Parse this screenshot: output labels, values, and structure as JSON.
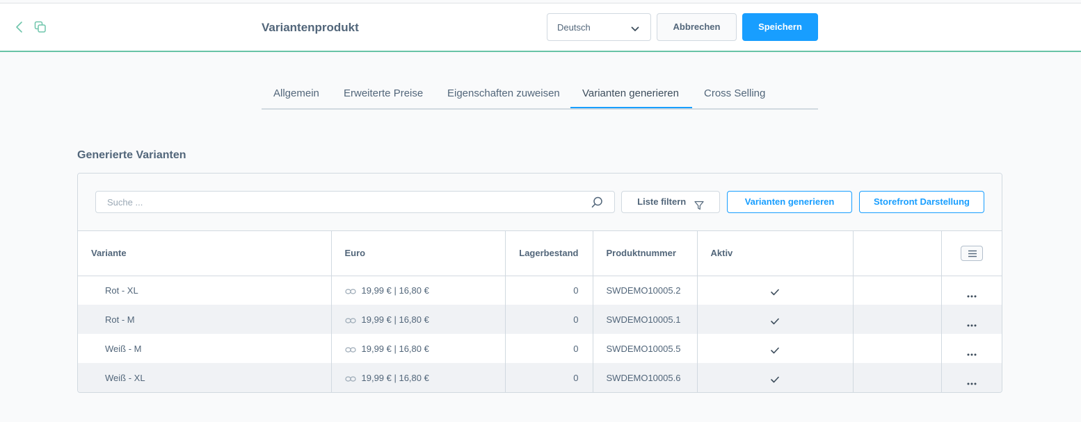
{
  "header": {
    "title": "Variantenprodukt",
    "language": "Deutsch",
    "cancel_label": "Abbrechen",
    "save_label": "Speichern"
  },
  "tabs": [
    {
      "label": "Allgemein",
      "active": false
    },
    {
      "label": "Erweiterte Preise",
      "active": false
    },
    {
      "label": "Eigenschaften zuweisen",
      "active": false
    },
    {
      "label": "Varianten generieren",
      "active": true
    },
    {
      "label": "Cross Selling",
      "active": false
    }
  ],
  "section": {
    "title": "Generierte Varianten"
  },
  "toolbar": {
    "search_placeholder": "Suche ...",
    "filter_label": "Liste filtern",
    "generate_label": "Varianten generieren",
    "storefront_label": "Storefront Darstellung"
  },
  "table": {
    "columns": {
      "variant": "Variante",
      "price": "Euro",
      "stock": "Lagerbestand",
      "number": "Produktnummer",
      "active": "Aktiv"
    },
    "rows": [
      {
        "variant": "Rot  -  XL",
        "price": "19,99 € | 16,80 €",
        "stock": "0",
        "number": "SWDEMO10005.2",
        "active": true
      },
      {
        "variant": "Rot  -  M",
        "price": "19,99 € | 16,80 €",
        "stock": "0",
        "number": "SWDEMO10005.1",
        "active": true
      },
      {
        "variant": "Weiß  -  M",
        "price": "19,99 € | 16,80 €",
        "stock": "0",
        "number": "SWDEMO10005.5",
        "active": true
      },
      {
        "variant": "Weiß  -  XL",
        "price": "19,99 € | 16,80 €",
        "stock": "0",
        "number": "SWDEMO10005.6",
        "active": true
      }
    ]
  },
  "colors": {
    "accent": "#189eff",
    "header_border": "#68c3a6",
    "text": "#52667a",
    "border": "#d1d9e0"
  },
  "icons": {
    "back": "chevron-left-icon",
    "duplicate": "copy-icon",
    "language_dropdown": "chevron-down-icon",
    "search": "search-icon",
    "filter": "funnel-icon",
    "price_link": "link-icon",
    "active": "checkmark-icon",
    "row_actions": "ellipsis-icon",
    "column_settings": "list-icon"
  }
}
